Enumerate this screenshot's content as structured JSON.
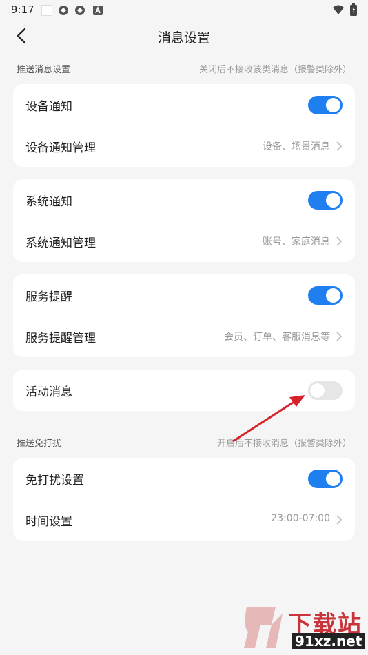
{
  "status_bar": {
    "time": "9:17"
  },
  "header": {
    "title": "消息设置"
  },
  "sections": {
    "push": {
      "label": "推送消息设置",
      "hint": "关闭后不接收该类消息（报警类除外）"
    },
    "dnd": {
      "label": "推送免打扰",
      "hint": "开启后不接收消息（报警类除外）"
    }
  },
  "cards": {
    "device": {
      "toggle_label": "设备通知",
      "toggle_on": true,
      "manage_label": "设备通知管理",
      "manage_value": "设备、场景消息"
    },
    "system": {
      "toggle_label": "系统通知",
      "toggle_on": true,
      "manage_label": "系统通知管理",
      "manage_value": "账号、家庭消息"
    },
    "service": {
      "toggle_label": "服务提醒",
      "toggle_on": true,
      "manage_label": "服务提醒管理",
      "manage_value": "会员、订单、客服消息等"
    },
    "activity": {
      "toggle_label": "活动消息",
      "toggle_on": false
    },
    "dnd": {
      "toggle_label": "免打扰设置",
      "toggle_on": true,
      "time_label": "时间设置",
      "time_value": "23:00-07:00"
    }
  },
  "colors": {
    "accent": "#1f7ff0",
    "toggle_off": "#e6e6e6",
    "arrow": "#d6232b"
  },
  "watermark": {
    "text": "下载站",
    "domain": "91xz.net"
  }
}
